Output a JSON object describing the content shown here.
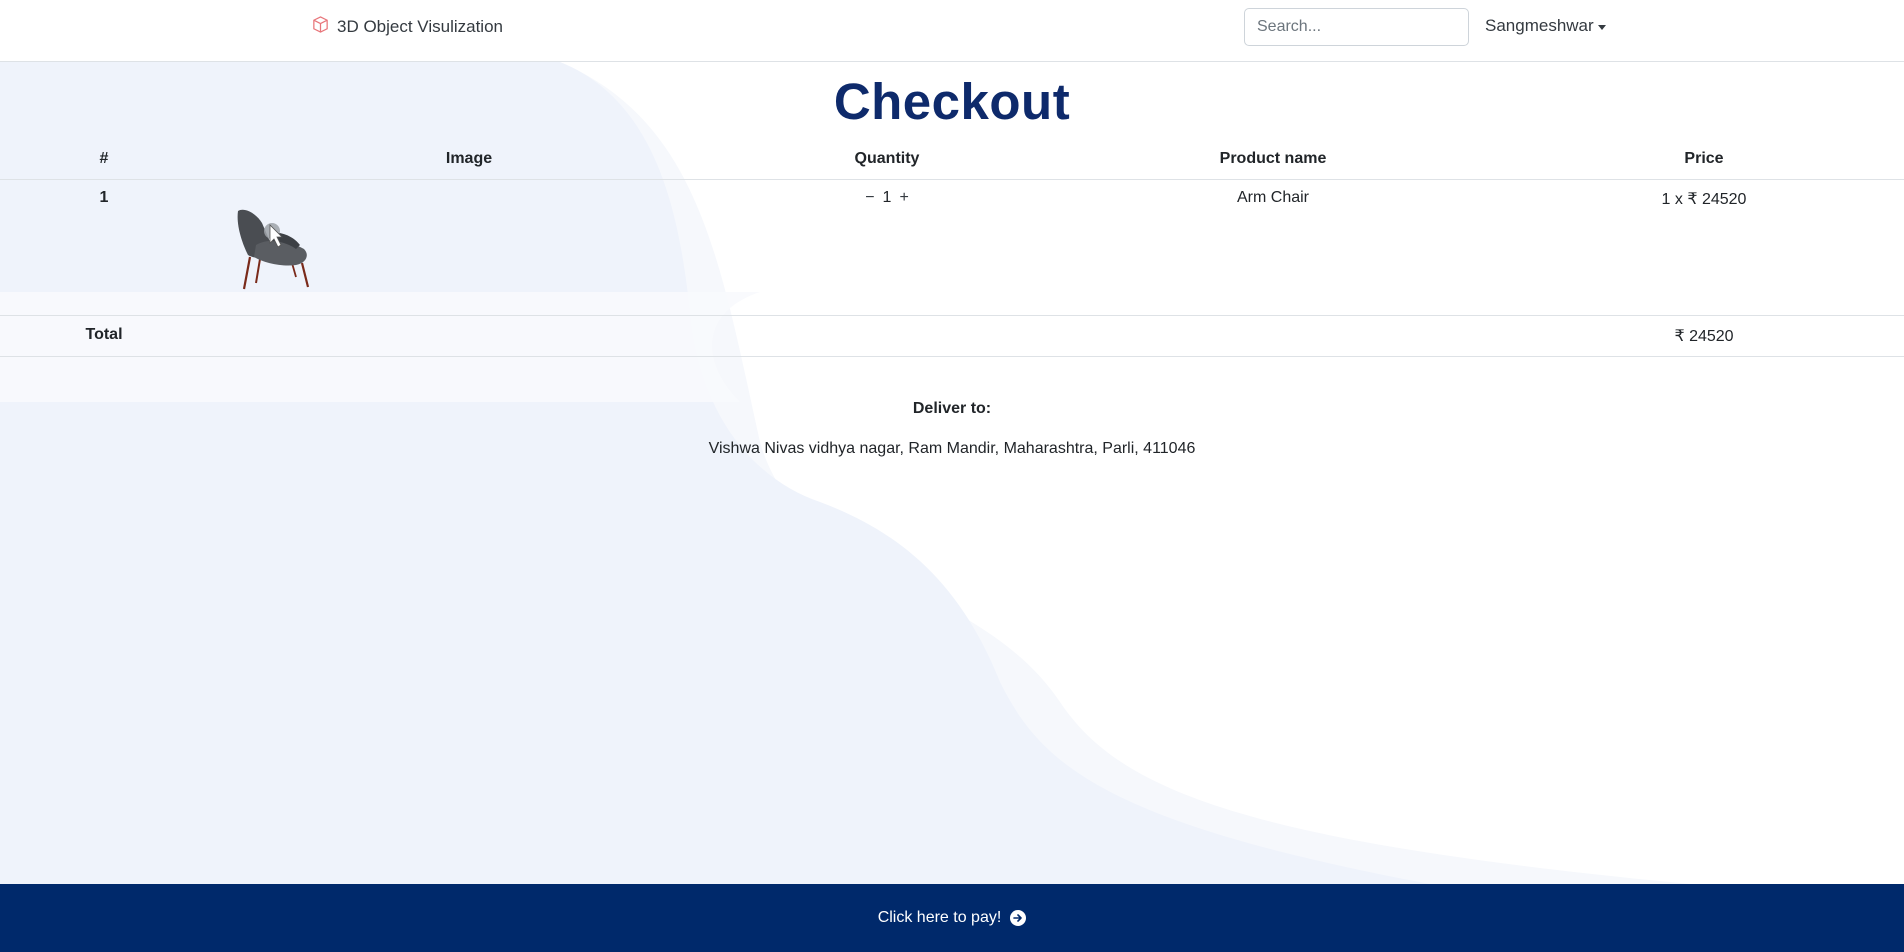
{
  "navbar": {
    "brand": "3D Object Visulization",
    "brand_icon": "cube-icon",
    "search_placeholder": "Search...",
    "user_name": "Sangmeshwar"
  },
  "page": {
    "title": "Checkout"
  },
  "table": {
    "headers": {
      "index": "#",
      "image": "Image",
      "quantity": "Quantity",
      "product_name": "Product name",
      "price": "Price"
    },
    "rows": [
      {
        "index": "1",
        "image": "arm-chair-image",
        "qty_minus": "−",
        "quantity": "1",
        "qty_plus": "+",
        "product_name": "Arm Chair",
        "price": "1 x ₹ 24520"
      }
    ],
    "total_label": "Total",
    "total_value": "₹ 24520"
  },
  "delivery": {
    "label": "Deliver to:",
    "address": "Vishwa Nivas vidhya nagar, Ram Mandir, Maharashtra, Parli, 411046"
  },
  "pay": {
    "label": "Click here to pay!",
    "icon": "arrow-right-circle-icon"
  },
  "colors": {
    "title": "#0e2a6b",
    "paybar": "#00296b",
    "bg_light": "#eff3fb",
    "bg_lighter": "#f6f8fc"
  }
}
